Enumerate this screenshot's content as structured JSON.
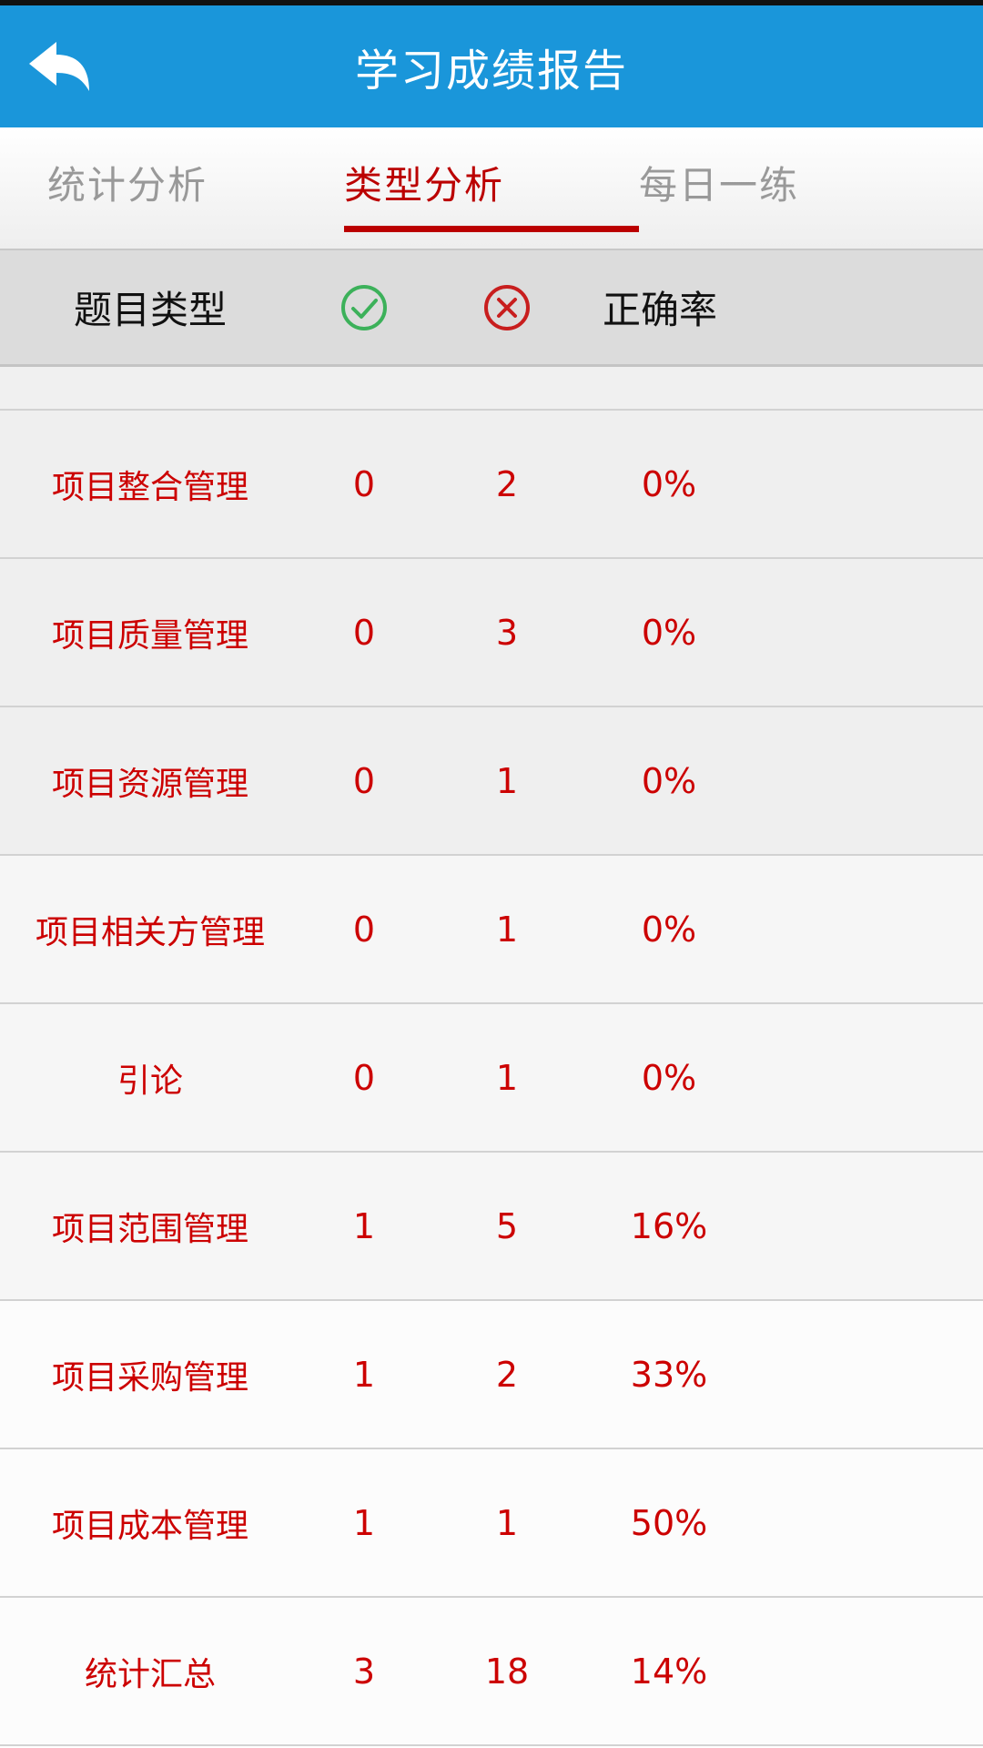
{
  "appbar": {
    "title": "学习成绩报告",
    "back_icon": "back-arrow-icon",
    "color": "#1a96da"
  },
  "tabs": [
    {
      "label": "统计分析",
      "active": false
    },
    {
      "label": "类型分析",
      "active": true
    },
    {
      "label": "每日一练",
      "active": false
    }
  ],
  "table": {
    "headers": {
      "type": "题目类型",
      "correct_icon": "check-circle-icon",
      "wrong_icon": "x-circle-icon",
      "rate": "正确率"
    },
    "rows": [
      {
        "name": "项目整合管理",
        "correct": "0",
        "wrong": "2",
        "rate": "0%"
      },
      {
        "name": "项目质量管理",
        "correct": "0",
        "wrong": "3",
        "rate": "0%"
      },
      {
        "name": "项目资源管理",
        "correct": "0",
        "wrong": "1",
        "rate": "0%"
      },
      {
        "name": "项目相关方管理",
        "correct": "0",
        "wrong": "1",
        "rate": "0%"
      },
      {
        "name": "引论",
        "correct": "0",
        "wrong": "1",
        "rate": "0%"
      },
      {
        "name": "项目范围管理",
        "correct": "1",
        "wrong": "5",
        "rate": "16%"
      },
      {
        "name": "项目采购管理",
        "correct": "1",
        "wrong": "2",
        "rate": "33%"
      },
      {
        "name": "项目成本管理",
        "correct": "1",
        "wrong": "1",
        "rate": "50%"
      },
      {
        "name": "统计汇总",
        "correct": "3",
        "wrong": "18",
        "rate": "14%"
      }
    ]
  },
  "colors": {
    "accent_red": "#bb0000",
    "value_red": "#cc0000",
    "correct_green": "#3cb15a",
    "wrong_red": "#c81e1e"
  }
}
